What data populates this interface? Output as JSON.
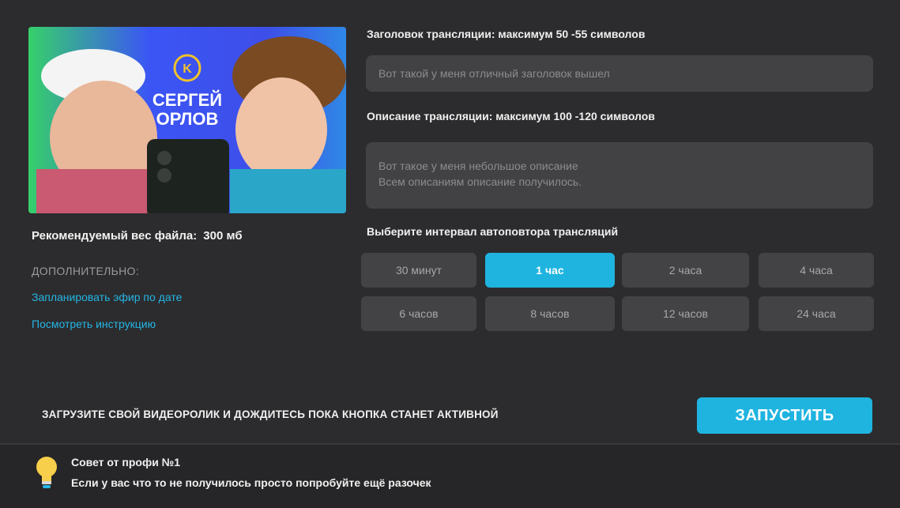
{
  "thumbnail": {
    "logo_letter": "K",
    "line1": "СЕРГЕЙ",
    "line2": "ОРЛОВ"
  },
  "file": {
    "weight_label": "Рекомендуемый вес файла:",
    "weight_value": "300 мб"
  },
  "extra": {
    "label": "ДОПОЛНИТЕЛЬНО:",
    "schedule_link": "Запланировать эфир по дате",
    "instructions_link": "Посмотреть инструкцию"
  },
  "form": {
    "title_label": "Заголовок трансляции: максимум 50 -55 символов",
    "title_value": "Вот такой у меня отличный заголовок вышел",
    "desc_label": "Описание трансляции: максимум 100 -120 символов",
    "desc_line1": "Вот такое у меня небольшое описание",
    "desc_line2": "Всем описаниям описание получилось.",
    "interval_label": "Выберите интервал автоповтора трансляций",
    "intervals": [
      "30 минут",
      "1 час",
      "2 часа",
      "4 часа",
      "6 часов",
      "8 часов",
      "12 часов",
      "24 часа"
    ],
    "selected_interval": "1 час"
  },
  "footer": {
    "upload_note": "ЗАГРУЗИТЕ СВОЙ ВИДЕОРОЛИК И ДОЖДИТЕСЬ ПОКА КНОПКА СТАНЕТ АКТИВНОЙ",
    "launch_label": "ЗАПУСТИТЬ"
  },
  "tip": {
    "title": "Совет от профи №1",
    "text": "Если у вас что то не получилось просто попробуйте ещё разочек",
    "icon": "lightbulb-icon"
  },
  "colors": {
    "background": "#2c2c2e",
    "accent": "#1fb4e0",
    "field": "#424244",
    "link": "#24b6e6"
  }
}
